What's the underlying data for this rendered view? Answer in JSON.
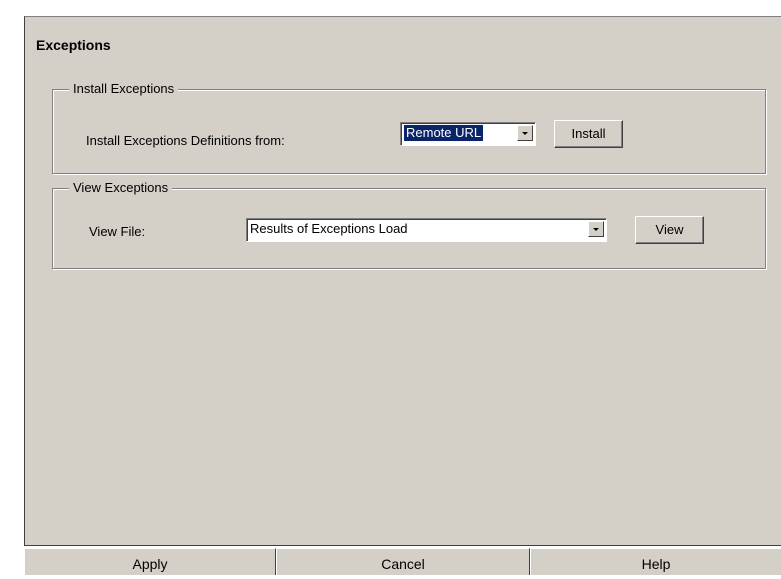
{
  "page": {
    "title": "Exceptions"
  },
  "install_group": {
    "legend": "Install Exceptions",
    "label": "Install Exceptions Definitions from:",
    "source_value": "Remote URL",
    "install_button": "Install"
  },
  "view_group": {
    "legend": "View Exceptions",
    "label": "View File:",
    "file_value": "Results of Exceptions Load",
    "view_button": "View"
  },
  "footer": {
    "apply": "Apply",
    "cancel": "Cancel",
    "help": "Help"
  },
  "colors": {
    "panel_bg": "#d4d0c8",
    "selection_bg": "#0a246a"
  }
}
